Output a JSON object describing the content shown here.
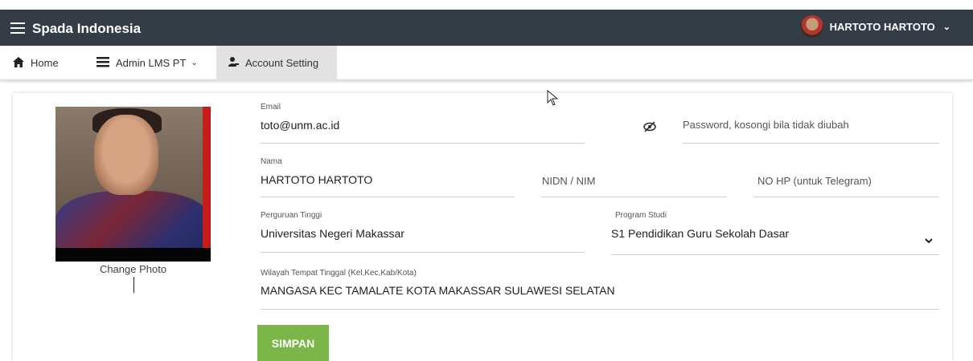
{
  "app": {
    "title": "Spada Indonesia"
  },
  "user": {
    "name": "HARTOTO HARTOTO"
  },
  "nav": {
    "home": "Home",
    "admin": "Admin LMS PT",
    "account": "Account Setting"
  },
  "profile": {
    "change_photo": "Change Photo"
  },
  "form": {
    "email_label": "Email",
    "email_value": "toto@unm.ac.id",
    "password_placeholder": "Password, kosongi bila tidak diubah",
    "nama_label": "Nama",
    "nama_value": "HARTOTO HARTOTO",
    "nidn_placeholder": "NIDN / NIM",
    "nohp_placeholder": "NO HP (untuk Telegram)",
    "pt_label": "Perguruan Tinggi",
    "pt_value": "Universitas Negeri Makassar",
    "prodi_label": "Program Studi",
    "prodi_value": "S1 Pendidikan Guru Sekolah Dasar",
    "wilayah_label": "Wilayah Tempat Tinggal (Kel,Kec,Kab/Kota)",
    "wilayah_value": "MANGASA KEC TAMALATE KOTA MAKASSAR SULAWESI SELATAN",
    "submit": "SIMPAN"
  },
  "colors": {
    "topbar": "#343c45",
    "accent": "#7ab648",
    "active_tab": "#e2e2e2"
  },
  "icons": [
    "menu-icon",
    "home-icon",
    "list-icon",
    "user-settings-icon",
    "eye-slash-icon",
    "chevron-down-icon"
  ]
}
